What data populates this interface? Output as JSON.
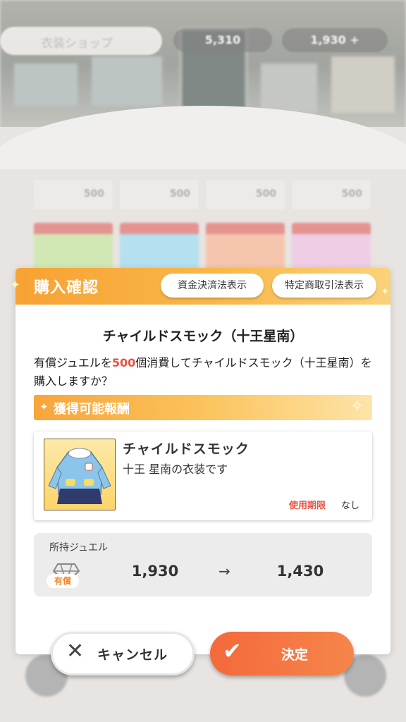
{
  "background": {
    "shop_name": "衣装ショップ",
    "currency_free": "5,310",
    "currency_paid": "1,930 +",
    "grid_prices": [
      "500",
      "500",
      "500",
      "500"
    ]
  },
  "dialog": {
    "title": "購入確認",
    "fund_settlement_button": "資金決済法表示",
    "commercial_transactions_button": "特定商取引法表示",
    "item_title": "チャイルドスモック（十王星南）",
    "confirm_prefix": "有償ジュエルを",
    "confirm_amount": "500",
    "confirm_suffix": "個消費してチャイルドスモック（十王星南）を購入しますか？",
    "reward_section": "獲得可能報酬",
    "item_card": {
      "name": "チャイルドスモック",
      "description": "十王 星南の衣装です",
      "expiry_label": "使用期限",
      "expiry_value": "なし"
    },
    "jewels": {
      "label": "所持ジュエル",
      "badge": "有償",
      "before": "1,930",
      "arrow": "→",
      "after": "1,430"
    }
  },
  "buttons": {
    "cancel": "キャンセル",
    "confirm": "決定"
  },
  "colors": {
    "accent_orange": "#f7a233",
    "highlight_red": "#e9523f",
    "confirm_button": "#f4693b"
  }
}
